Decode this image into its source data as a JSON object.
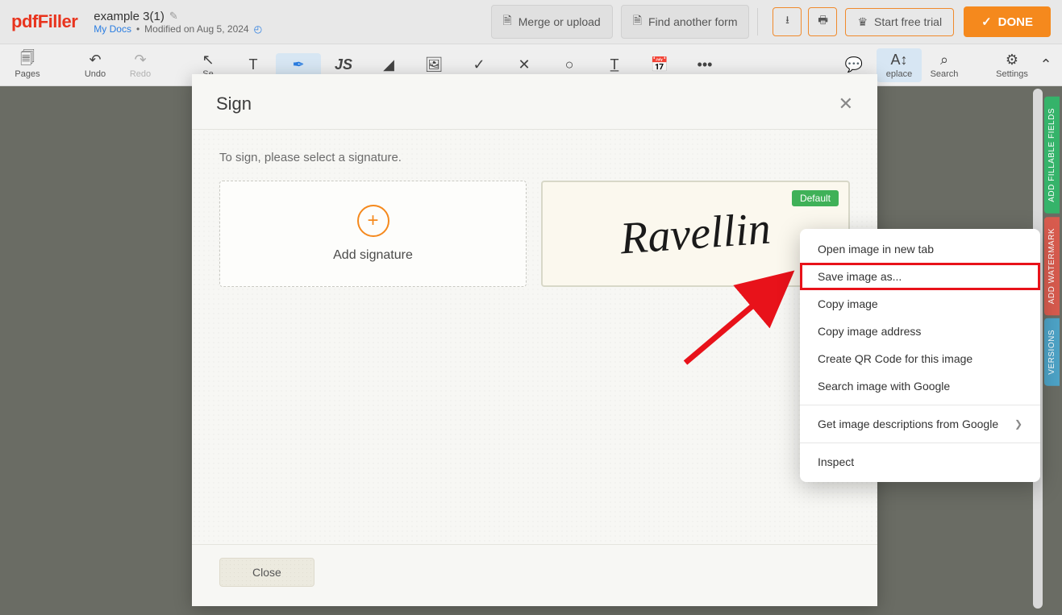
{
  "app": {
    "logo": "pdfFiller"
  },
  "doc": {
    "title": "example 3(1)",
    "my_docs": "My Docs",
    "modified": "Modified on Aug 5, 2024"
  },
  "topbar": {
    "merge": "Merge or upload",
    "find": "Find another form",
    "trial": "Start free trial",
    "done": "DONE"
  },
  "toolbar": {
    "pages": "Pages",
    "undo": "Undo",
    "redo": "Redo",
    "select": "Se",
    "replace": "eplace",
    "search": "Search",
    "settings": "Settings"
  },
  "side": {
    "fields": "ADD FILLABLE FIELDS",
    "watermark": "ADD WATERMARK",
    "versions": "VERSIONS"
  },
  "modal": {
    "title": "Sign",
    "prompt": "To sign, please select a signature.",
    "add_label": "Add signature",
    "default_badge": "Default",
    "signature_text": "Ravellin",
    "close": "Close"
  },
  "context_menu": {
    "items": [
      "Open image in new tab",
      "Save image as...",
      "Copy image",
      "Copy image address",
      "Create QR Code for this image",
      "Search image with Google"
    ],
    "descriptions": "Get image descriptions from Google",
    "inspect": "Inspect"
  }
}
